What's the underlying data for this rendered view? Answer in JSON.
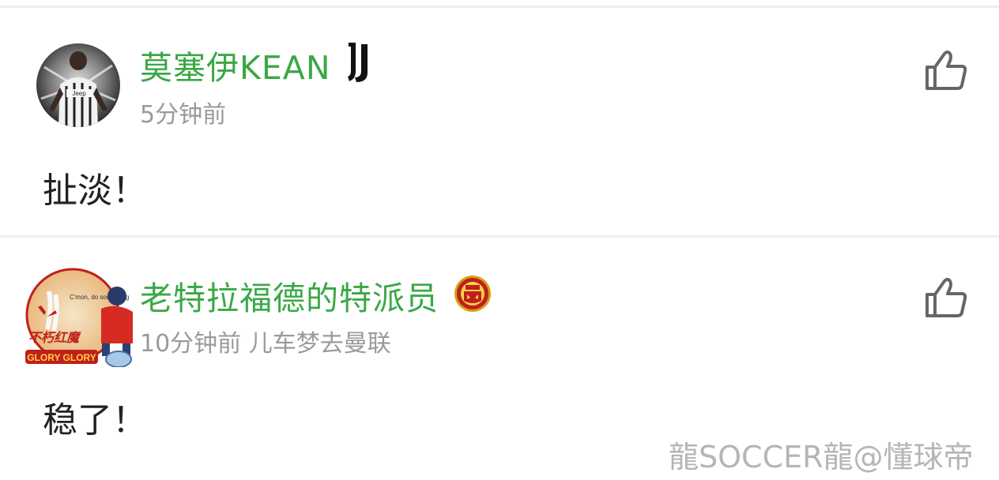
{
  "comments": [
    {
      "username": "莫塞伊KEAN",
      "badge_icon": "juventus-logo",
      "meta": "5分钟前",
      "text": "扯淡！",
      "avatar_icon": "player-avatar",
      "like_icon": "thumbs-up-icon"
    },
    {
      "username": "老特拉福德的特派员",
      "badge_icon": "manchester-united-crest",
      "meta": "10分钟前 儿车梦去曼联",
      "text": "稳了！",
      "avatar_icon": "glory-glory-avatar",
      "avatar_caption": "C'mon, do something",
      "avatar_banner": "GLORY GLORY",
      "like_icon": "thumbs-up-icon"
    }
  ],
  "watermark": "龍SOCCER龍@懂球帝",
  "colors": {
    "username": "#3aa845",
    "meta": "#9a9a9a",
    "text": "#222222",
    "divider": "#eeeeee",
    "icon": "#666666"
  }
}
